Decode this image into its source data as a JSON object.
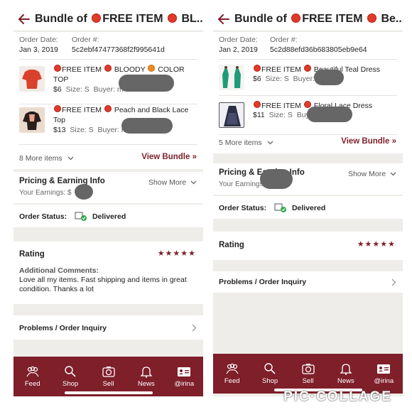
{
  "left": {
    "title_prefix": "Bundle of ",
    "title_mid": "FREE ITEM ",
    "title_suffix": " BL...",
    "order_date_label": "Order Date:",
    "order_date": "Jan 3, 2019",
    "order_num_label": "Order #:",
    "order_num": "5c2ebf47477368f2f995641d",
    "items": [
      {
        "title_a": "FREE ITEM ",
        "title_b": " BLOODY ",
        "title_c": " COLOR",
        "title_line2": "TOP",
        "price": "$6",
        "size": "Size: S",
        "buyer": "Buyer: m"
      },
      {
        "title_a": "FREE ITEM ",
        "title_b": " Peach and Black Lace",
        "title_c": "",
        "title_line2": "Top",
        "price": "$13",
        "size": "Size: S",
        "buyer": "Buyer: m"
      }
    ],
    "more_items": "8 More items",
    "view_bundle": "View Bundle »",
    "pricing_title": "Pricing & Earning Info",
    "show_more": "Show More",
    "earnings": "Your Earnings: $",
    "order_status_label": "Order Status:",
    "order_status": "Delivered",
    "rating_label": "Rating",
    "stars": "★★★★★",
    "comments_label": "Additional Comments:",
    "comments": "Love all my items. Fast shipping and items in great condition. Thanks a lot",
    "problems": "Problems / Order Inquiry"
  },
  "right": {
    "title_prefix": "Bundle of ",
    "title_mid": "FREE ITEM ",
    "title_suffix": " Be...",
    "order_date_label": "Order Date:",
    "order_date": "Jan 2, 2019",
    "order_num_label": "Order #:",
    "order_num": "5c2d88efd36b683805eb9e64",
    "items": [
      {
        "title_a": "FREE ITEM ",
        "title_b": " Beautiful Teal Dress",
        "price": "$6",
        "size": "Size: S",
        "buyer": "Buyer:"
      },
      {
        "title_a": "FREE ITEM ",
        "title_b": " Floral Lace Dress",
        "price": "$11",
        "size": "Size: S",
        "buyer": "Buye"
      }
    ],
    "more_items": "5 More items",
    "view_bundle": "View Bundle »",
    "pricing_title": "Pricing & Earning Info",
    "show_more": "Show More",
    "earnings": "Your Earnings",
    "order_status_label": "Order Status:",
    "order_status": "Delivered",
    "rating_label": "Rating",
    "stars": "★★★★★",
    "problems": "Problems / Order Inquiry"
  },
  "tabs": [
    {
      "label": "Feed",
      "icon": "feed-icon"
    },
    {
      "label": "Shop",
      "icon": "search-icon"
    },
    {
      "label": "Sell",
      "icon": "camera-icon"
    },
    {
      "label": "News",
      "icon": "bell-icon"
    },
    {
      "label": "@irina",
      "icon": "profile-card-icon"
    }
  ],
  "brand": "PIC·COLLAGE",
  "colors": {
    "accent": "#7e1f2a",
    "dot": "#e23a2a",
    "delivered": "#2ea84a",
    "background": "#efede9"
  }
}
